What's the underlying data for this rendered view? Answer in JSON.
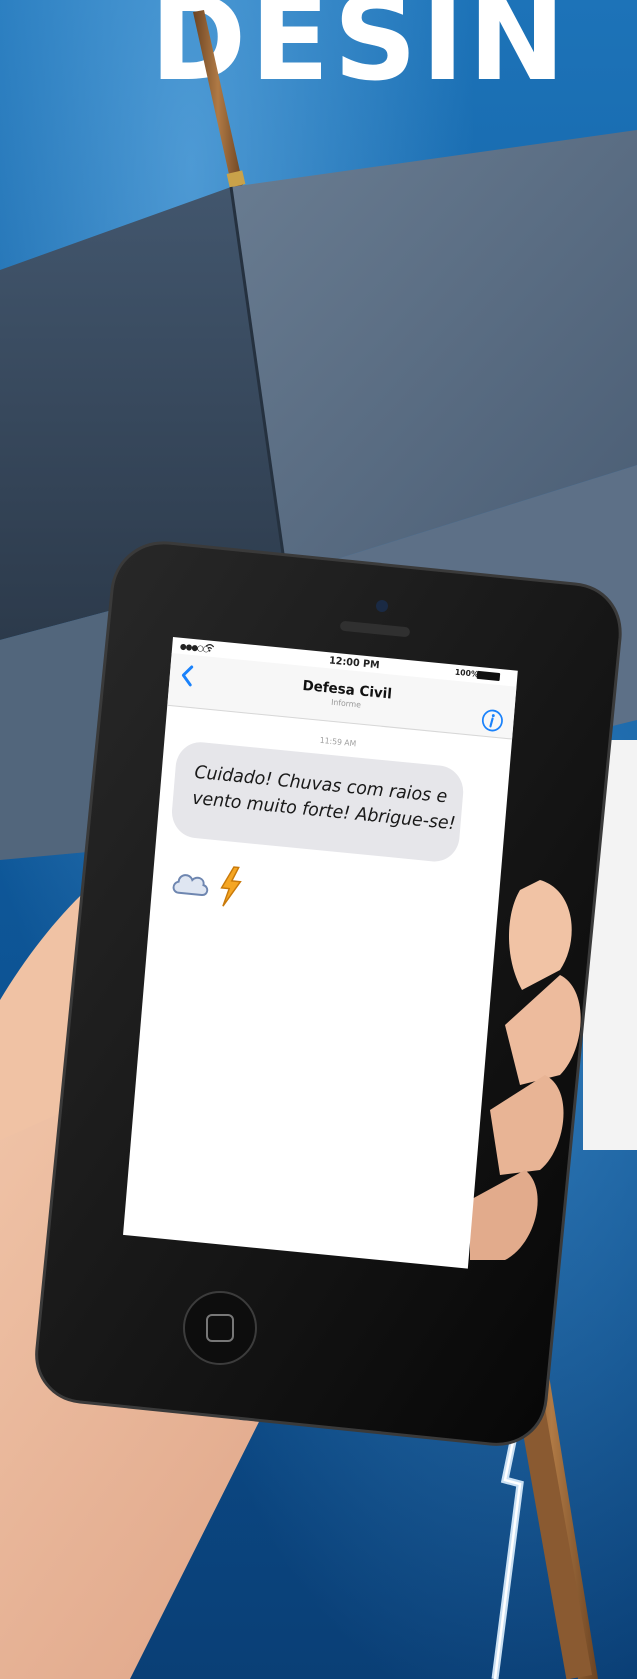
{
  "poster": {
    "headline": "DESIN"
  },
  "status_bar": {
    "time": "12:00 PM",
    "battery": "100%",
    "signal_icon": "signal-dots-icon",
    "wifi_icon": "wifi-icon"
  },
  "conversation": {
    "back_icon": "chevron-left-icon",
    "contact_name": "Defesa Civil",
    "contact_subtitle": "Informe",
    "info_icon": "info-circle-icon",
    "message_time": "11:59 AM",
    "message_lines": [
      "Cuidado! Chuvas com raios e",
      "vento muito forte! Abrigue-se!"
    ],
    "emojis": [
      "cloud-icon",
      "lightning-bolt-icon"
    ]
  },
  "device": {
    "home_button_icon": "home-button-icon"
  },
  "colors": {
    "sky_blue": "#1d73b8",
    "umbrella": "#3c5068",
    "ios_blue": "#1a82fb",
    "bubble_gray": "#e6e6ea",
    "bolt_orange": "#f5a623",
    "headline": "#ffffff"
  }
}
